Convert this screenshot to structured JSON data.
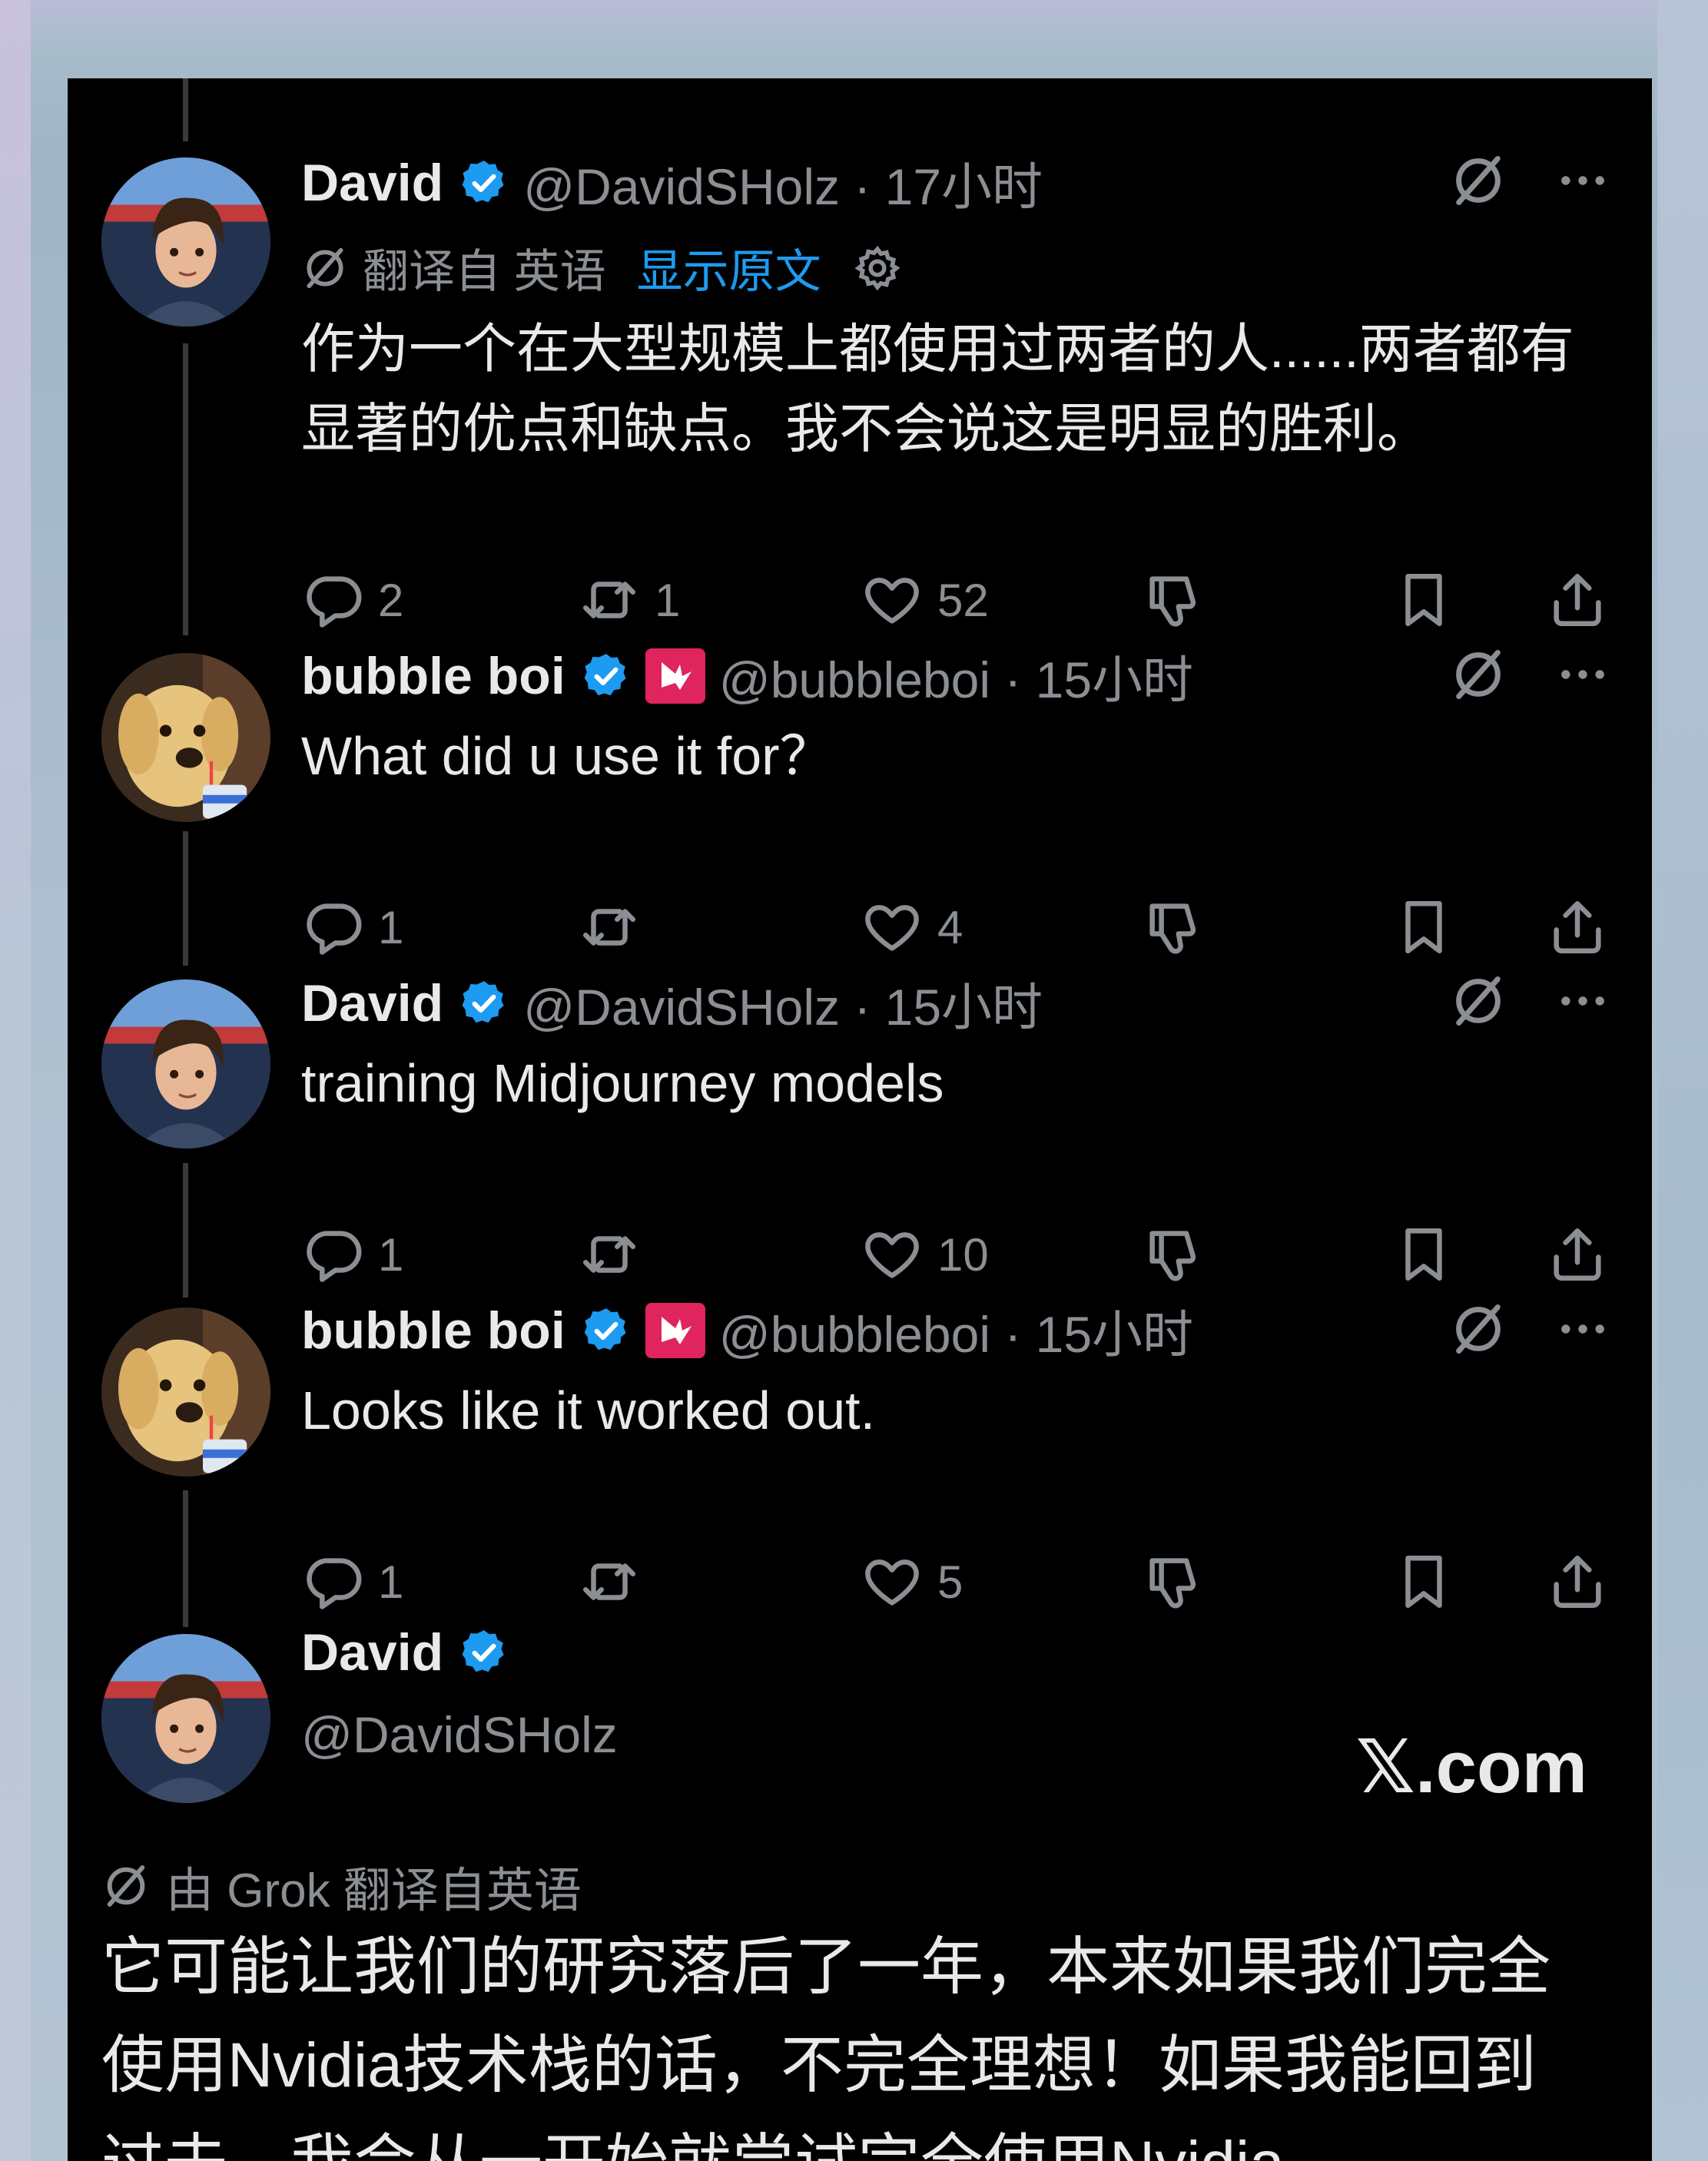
{
  "posts": [
    {
      "author": "David",
      "handle_time": "@DavidSHolz · 17小时",
      "translation": {
        "label": "翻译自 英语",
        "show_original": "显示原文"
      },
      "text": "作为一个在大型规模上都使用过两者的人......两者都有显著的优点和缺点。我不会说这是明显的胜利。",
      "stats": {
        "replies": "2",
        "reposts": "1",
        "likes": "52"
      }
    },
    {
      "author": "bubble boi",
      "handle_time": "@bubbleboi · 15小时",
      "text": "What did u use it for？",
      "stats": {
        "replies": "1",
        "reposts": "",
        "likes": "4"
      }
    },
    {
      "author": "David",
      "handle_time": "@DavidSHolz · 15小时",
      "text": "training Midjourney models",
      "stats": {
        "replies": "1",
        "reposts": "",
        "likes": "10"
      }
    },
    {
      "author": "bubble boi",
      "handle_time": "@bubbleboi · 15小时",
      "text": "Looks like it worked out.",
      "stats": {
        "replies": "1",
        "reposts": "",
        "likes": "5"
      }
    }
  ],
  "final_post": {
    "author": "David",
    "handle": "@DavidSHolz",
    "brand": "𝕏.com",
    "grok_label": "由 Grok 翻译自英语",
    "text": "它可能让我们的研究落后了一年，本来如果我们完全使用Nvidia技术栈的话，不完全理想！如果我能回到过去，我会从一开始就尝试完全使用Nvidia。"
  },
  "colors": {
    "verified": "#1d9bf0",
    "link": "#1d9bf0",
    "muted": "#8b8f94",
    "text": "#e7e9ea",
    "brand_badge": "#e0245e"
  },
  "icons": [
    "verified-icon",
    "grok-icon",
    "more-icon",
    "translate-icon",
    "gear-icon",
    "reply-icon",
    "repost-icon",
    "like-icon",
    "dislike-icon",
    "bookmark-icon",
    "share-icon",
    "brand-bird-icon"
  ]
}
